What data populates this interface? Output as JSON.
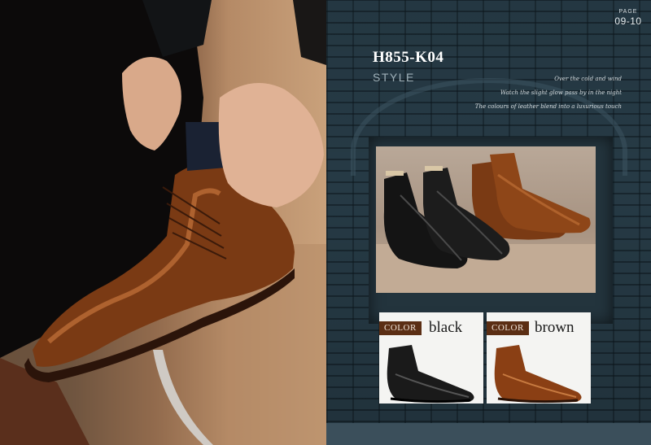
{
  "page": {
    "label": "PAGE",
    "number": "09-10"
  },
  "product": {
    "model_code": "H855-K04",
    "section_label": "STYLE",
    "taglines": [
      "Over the cold and wind",
      "Watch the slight glow pass by in the night",
      "The colours of leather blend into a luxurious touch"
    ]
  },
  "color_options": {
    "tag_label": "COLOR",
    "options": [
      {
        "name": "black",
        "hex": "#1a1a1a"
      },
      {
        "name": "brown",
        "hex": "#8a3f14"
      }
    ]
  },
  "colors": {
    "brick_wall": "#263a45",
    "tag_background": "#5b2e14",
    "tan_leather": "#9a4e1e"
  }
}
